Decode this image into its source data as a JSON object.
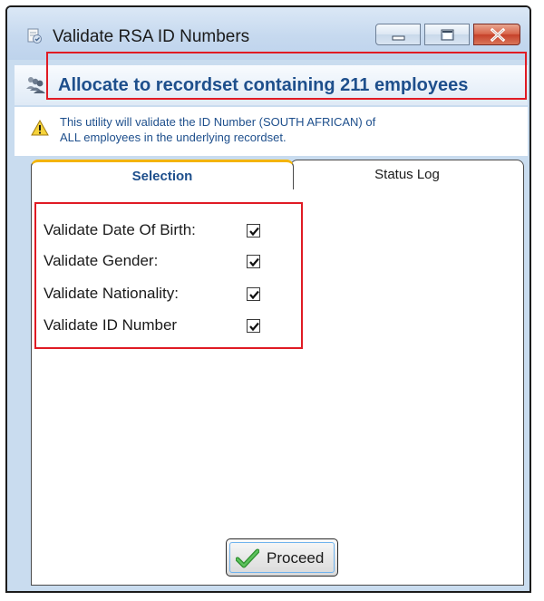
{
  "window": {
    "title": "Validate RSA ID Numbers",
    "icon": "document-validate-icon"
  },
  "caption_buttons": {
    "minimize_icon": "minimize-icon",
    "maximize_icon": "maximize-icon",
    "close_icon": "close-icon"
  },
  "header": {
    "icon": "people-group-icon",
    "title": "Allocate to recordset containing 211 employees"
  },
  "info": {
    "icon": "warning-icon",
    "line1": "This utility will validate the ID Number (SOUTH AFRICAN) of",
    "line2": "ALL employees in the underlying recordset."
  },
  "tabs": [
    {
      "label": "Selection",
      "selected": true
    },
    {
      "label": "Status Log",
      "selected": false
    }
  ],
  "options": [
    {
      "label": "Validate Date Of Birth:",
      "checked": true
    },
    {
      "label": "Validate Gender:",
      "checked": true
    },
    {
      "label": "Validate Nationality:",
      "checked": true
    },
    {
      "label": "Validate ID Number",
      "checked": true
    }
  ],
  "proceed": {
    "label": "Proceed",
    "icon": "checkmark-icon"
  },
  "colors": {
    "accent_blue": "#1e4f8c",
    "highlight_red": "#e01b24",
    "tab_gold": "#f4b400",
    "check_green": "#3aa43a"
  }
}
